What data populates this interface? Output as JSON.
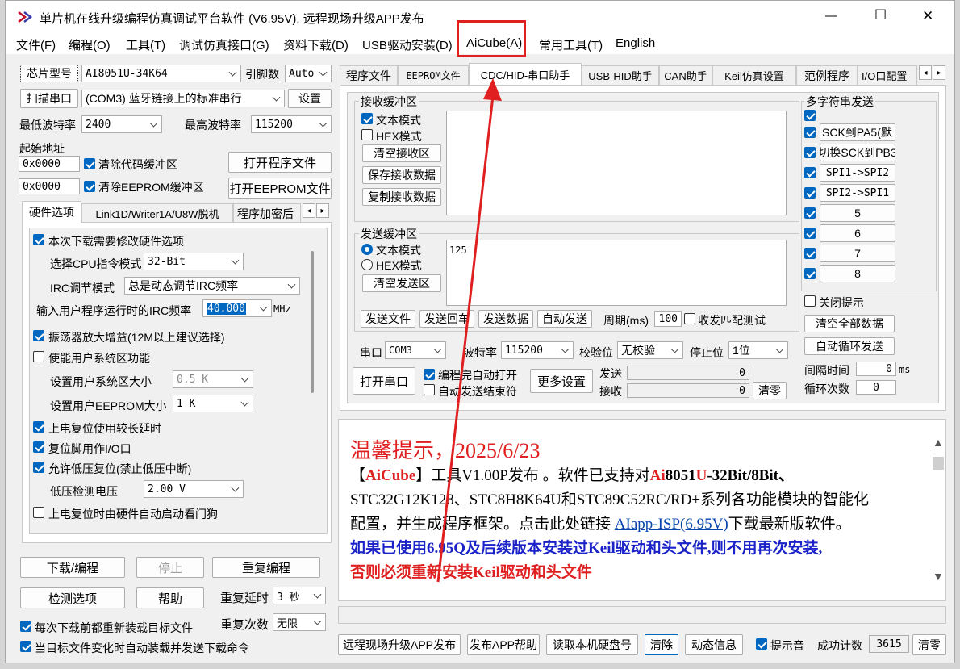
{
  "window": {
    "title": "单片机在线升级编程仿真调试平台软件 (V6.95V), 远程现场升级APP发布",
    "minimize_glyph": "—",
    "maximize_glyph": "☐",
    "close_glyph": "✕"
  },
  "menu": [
    "文件(F)",
    "编程(O)",
    "工具(T)",
    "调试仿真接口(G)",
    "资料下载(D)",
    "USB驱动安装(D)",
    "AiCube(A)",
    "常用工具(T)",
    "English"
  ],
  "highlight_color": "#e02020",
  "left": {
    "chip_model_label": "芯片型号",
    "chip_model_value": "AI8051U-34K64",
    "pin_count_label": "引脚数",
    "pin_count_value": "Auto",
    "scan_port_label": "扫描串口",
    "port_value": "(COM3) 蓝牙链接上的标准串行",
    "settings_label": "设置",
    "min_baud_label": "最低波特率",
    "min_baud_value": "2400",
    "max_baud_label": "最高波特率",
    "max_baud_value": "115200",
    "start_addr_label": "起始地址",
    "code_addr": "0x0000",
    "clear_code_label": "清除代码缓冲区",
    "open_prog_label": "打开程序文件",
    "eeprom_addr": "0x0000",
    "clear_eeprom_label": "清除EEPROM缓冲区",
    "open_eeprom_label": "打开EEPROM文件",
    "tabs": [
      "硬件选项",
      "Link1D/Writer1A/U8W脱机",
      "程序加密后"
    ],
    "hw": {
      "modify_label": "本次下载需要修改硬件选项",
      "cpu_mode_label": "选择CPU指令模式",
      "cpu_mode_value": "32-Bit",
      "irc_mode_label": "IRC调节模式",
      "irc_mode_value": "总是动态调节IRC频率",
      "irc_freq_label": "输入用户程序运行时的IRC频率",
      "irc_freq_value": "40.000",
      "mhz_label": "MHz",
      "osc_gain_label": "振荡器放大增益(12M以上建议选择)",
      "user_sys_label": "使能用户系统区功能",
      "user_sys_size_label": "设置用户系统区大小",
      "user_sys_size_value": "0.5 K",
      "user_eeprom_label": "设置用户EEPROM大小",
      "user_eeprom_value": "1   K",
      "long_delay_label": "上电复位使用较长延时",
      "reset_io_label": "复位脚用作I/O口",
      "lvr_label": "允许低压复位(禁止低压中断)",
      "lvd_label": "低压检测电压",
      "lvd_value": "2.00 V",
      "wdt_label": "上电复位时由硬件自动启动看门狗"
    },
    "download_label": "下载/编程",
    "stop_label": "停止",
    "redo_label": "重复编程",
    "detect_label": "检测选项",
    "help_label": "帮助",
    "redo_delay_label": "重复延时",
    "redo_delay_value": "3 秒",
    "redo_count_label": "重复次数",
    "redo_count_value": "无限",
    "reload_label": "每次下载前都重新装载目标文件",
    "auto_reload_label": "当目标文件变化时自动装载并发送下载命令"
  },
  "right_tabs": [
    "程序文件",
    "EEPROM文件",
    "CDC/HID-串口助手",
    "USB-HID助手",
    "CAN助手",
    "Keil仿真设置",
    "范例程序",
    "I/O口配置"
  ],
  "serial": {
    "rx_group": "接收缓冲区",
    "text_mode": "文本模式",
    "hex_mode": "HEX模式",
    "clear_rx": "清空接收区",
    "save_rx": "保存接收数据",
    "copy_rx": "复制接收数据",
    "tx_group": "发送缓冲区",
    "tx_value": "125",
    "clear_tx": "清空发送区",
    "send_file": "发送文件",
    "send_enter": "发送回车",
    "send_data": "发送数据",
    "auto_send": "自动发送",
    "period_label": "周期(ms)",
    "period_value": "100",
    "match_test": "收发匹配测试",
    "port_label": "串口",
    "port_value": "COM3",
    "baud_label": "波特率",
    "baud_value": "115200",
    "parity_label": "校验位",
    "parity_value": "无校验",
    "stop_label": "停止位",
    "stop_value": "1位",
    "open_port": "打开串口",
    "auto_open": "编程完自动打开",
    "auto_close": "自动发送结束符",
    "more_settings": "更多设置",
    "send_count_label": "发送",
    "send_count": "0",
    "recv_count_label": "接收",
    "recv_count": "0",
    "clear_counts": "清零"
  },
  "multi": {
    "title": "多字符串发送",
    "items": [
      "\u0004SCK到PA5(默",
      "切换SCK到PB3",
      "SPI1->SPI2",
      "SPI2->SPI1",
      "5",
      "6",
      "7",
      "8"
    ],
    "close_tip": "关闭提示",
    "clear_all": "清空全部数据",
    "auto_loop": "自动循环发送",
    "interval_label": "间隔时间",
    "interval_value": "0",
    "interval_unit": "ms",
    "loop_label": "循环次数",
    "loop_value": "0"
  },
  "notice": {
    "title": "温馨提示，2025/6/23",
    "l1_a": "【",
    "l1_b": "AiCube",
    "l1_c": "】工具V1.00P发布 。软件已支持对",
    "l1_d": "Ai",
    "l1_e": "8051",
    "l1_f": "U",
    "l1_g": "-32Bit/8Bit、",
    "l2": "STC32G12K128、STC8H8K64U和STC89C52RC/RD+系列各功能模块的智能化",
    "l3_a": "配置，并生成程序框架。点击此处链接 ",
    "l3_link": "AIapp-ISP(6.95V)",
    "l3_b": "下载最新版软件。",
    "l4": "如果已使用6.95Q及后续版本安装过Keil驱动和头文件,则不用再次安装,",
    "l5": "否则必须重新安装Keil驱动和头文件"
  },
  "bottom": {
    "remote": "远程现场升级APP发布",
    "app_help": "发布APP帮助",
    "read_disk": "读取本机硬盘号",
    "clear": "清除",
    "dynamic": "动态信息",
    "beep": "提示音",
    "success_label": "成功计数",
    "success_count": "3615",
    "reset": "清零"
  }
}
